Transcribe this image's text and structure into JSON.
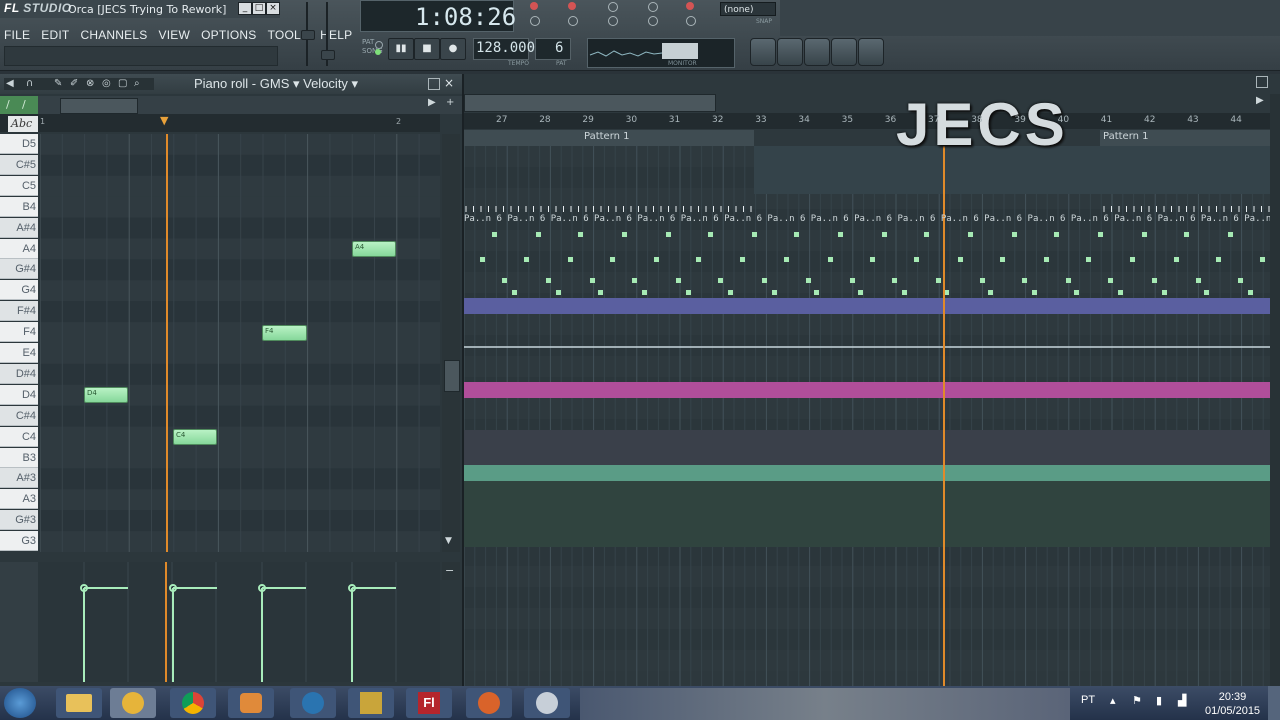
{
  "app": {
    "logo_main": "FL",
    "logo_sub": "STUDIO",
    "project_title": "Orca [JECS Trying To Rework]",
    "win_min": "_",
    "win_max": "□",
    "win_close": "×"
  },
  "menu": [
    "FILE",
    "EDIT",
    "CHANNELS",
    "VIEW",
    "OPTIONS",
    "TOOLS",
    "HELP"
  ],
  "transport": {
    "time": "1:08:26",
    "pat_label": "PAT",
    "song_label": "SONG",
    "tempo": "128.000",
    "tempo_label": "TEMPO",
    "pattern": "6",
    "pattern_label": "PAT",
    "snap": "(none)",
    "snap_label": "SNAP",
    "monitor_label": "MONITOR"
  },
  "piano_roll": {
    "title": "Piano roll - GMS",
    "mode": "Velocity",
    "abc": "Abc",
    "ruler": [
      "1",
      "2"
    ],
    "keys": [
      "D5",
      "C#5",
      "C5",
      "B4",
      "A#4",
      "A4",
      "G#4",
      "G4",
      "F#4",
      "F4",
      "E4",
      "D#4",
      "D4",
      "C#4",
      "C4",
      "B3",
      "A#3",
      "A3",
      "G#3",
      "G3"
    ],
    "notes": [
      {
        "label": "A4"
      },
      {
        "label": "F4"
      },
      {
        "label": "D4"
      },
      {
        "label": "C4"
      }
    ]
  },
  "playlist": {
    "ruler": [
      "27",
      "28",
      "29",
      "30",
      "31",
      "32",
      "33",
      "34",
      "35",
      "36",
      "37",
      "38",
      "39",
      "40",
      "41",
      "42",
      "43",
      "44"
    ],
    "patterns": [
      "Pattern 1",
      "Pattern 1"
    ],
    "pattern_strip": "Pa..n 6 Pa..n 6 Pa..n 6 Pa..n 6 Pa..n 6 Pa..n 6 Pa..n 6 Pa..n 6 Pa..n 6 Pa..n 6 Pa..n 6 Pa..n 6 Pa..n 6 Pa..n 6 Pa..n 6 Pa..n 6 Pa..n 6 Pa..n 6 Pa..n 6",
    "overlay": "JECS"
  },
  "taskbar": {
    "lang": "PT",
    "time": "20:39",
    "date": "01/05/2015"
  },
  "colors": {
    "note": "#9fe6b0",
    "playhead": "#e08a2a",
    "band_blue": "#5a5fa0",
    "band_pink": "#b04e9a",
    "band_green": "#5a9c86"
  }
}
